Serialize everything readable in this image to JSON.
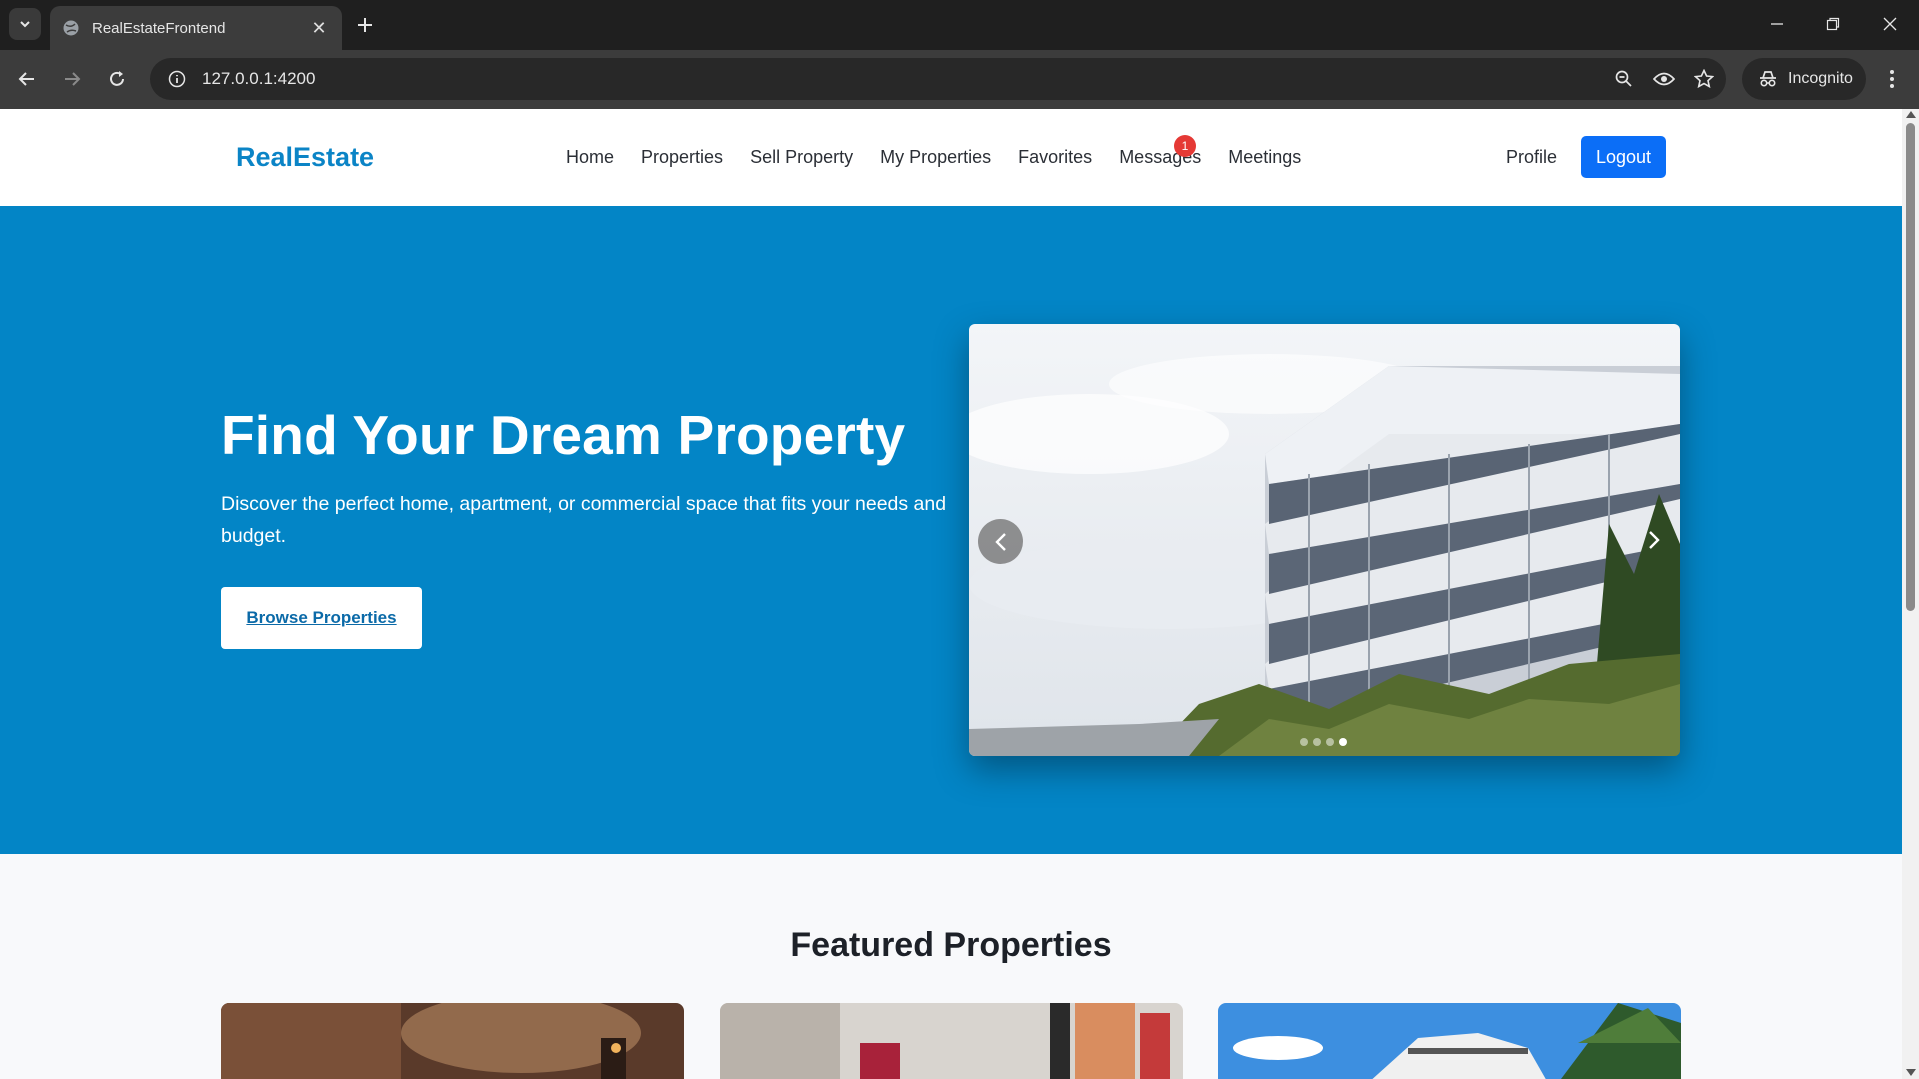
{
  "browser": {
    "tab_title": "RealEstateFrontend",
    "url": "127.0.0.1:4200",
    "incognito_label": "Incognito"
  },
  "site": {
    "brand": "RealEstate",
    "nav": [
      "Home",
      "Properties",
      "Sell Property",
      "My Properties",
      "Favorites",
      "Messages",
      "Meetings"
    ],
    "messages_badge": "1",
    "profile_label": "Profile",
    "logout_label": "Logout"
  },
  "hero": {
    "title": "Find Your Dream Property",
    "subtitle": "Discover the perfect home, apartment, or commercial space that fits your needs and budget.",
    "cta_label": "Browse Properties",
    "carousel": {
      "slide_count": 4,
      "active_slide": 4
    }
  },
  "featured": {
    "title": "Featured Properties",
    "cards": 3
  },
  "colors": {
    "hero_bg": "#0385c6",
    "brand": "#0b84c6",
    "primary_button": "#0b6ef7",
    "badge": "#e53935"
  }
}
